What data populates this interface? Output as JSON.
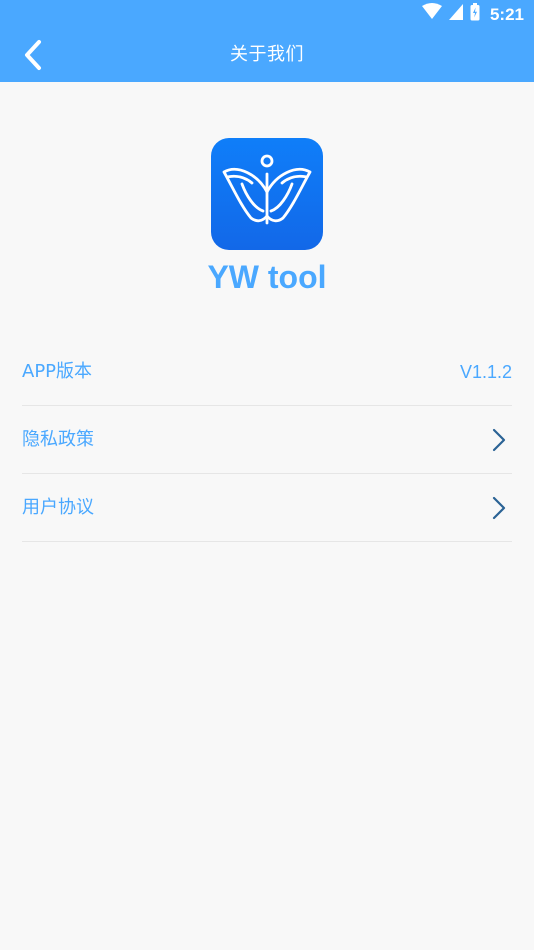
{
  "status_bar": {
    "time": "5:21",
    "icons": [
      "wifi-icon",
      "signal-icon",
      "battery-icon"
    ]
  },
  "app_bar": {
    "title": "关于我们",
    "back_icon": "back-chevron-icon"
  },
  "app": {
    "name": "YW tool",
    "logo_icon": "app-logo-icon"
  },
  "list": {
    "items": [
      {
        "label": "APP版本",
        "value": "V1.1.2"
      },
      {
        "label": "隐私政策",
        "icon": "chevron-right-icon"
      },
      {
        "label": "用户协议",
        "icon": "chevron-right-icon"
      }
    ]
  },
  "colors": {
    "primary": "#4aa8ff",
    "logo_blue": "#1268e8",
    "background": "#f8f8f8",
    "divider": "#e6e6e6",
    "chevron": "#2b6395",
    "white": "#ffffff"
  }
}
